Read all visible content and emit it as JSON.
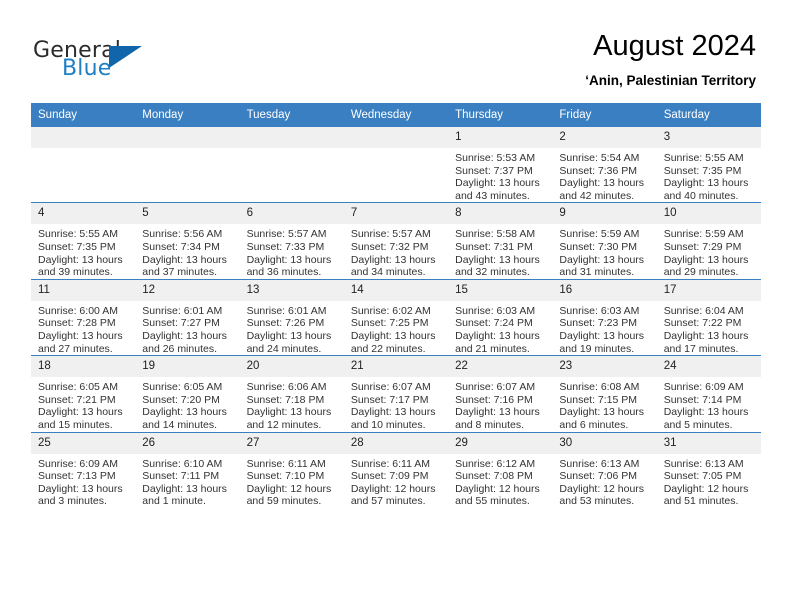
{
  "brand": {
    "name_top": "General",
    "name_bottom": "Blue",
    "accent_color": "#1166ab",
    "text_color": "#1f7fc4"
  },
  "header": {
    "title": "August 2024",
    "subtitle": "‘Anin, Palestinian Territory"
  },
  "theme": {
    "header_row_bg": "#3a7fc1",
    "daynum_bg": "#f0f0f0",
    "grid_line": "#3a7fc1",
    "body_text": "#333333"
  },
  "weekday_headers": [
    "Sunday",
    "Monday",
    "Tuesday",
    "Wednesday",
    "Thursday",
    "Friday",
    "Saturday"
  ],
  "weeks": [
    [
      {
        "day": "",
        "empty": true
      },
      {
        "day": "",
        "empty": true
      },
      {
        "day": "",
        "empty": true
      },
      {
        "day": "",
        "empty": true
      },
      {
        "day": "1",
        "sunrise": "Sunrise: 5:53 AM",
        "sunset": "Sunset: 7:37 PM",
        "daylight": "Daylight: 13 hours and 43 minutes."
      },
      {
        "day": "2",
        "sunrise": "Sunrise: 5:54 AM",
        "sunset": "Sunset: 7:36 PM",
        "daylight": "Daylight: 13 hours and 42 minutes."
      },
      {
        "day": "3",
        "sunrise": "Sunrise: 5:55 AM",
        "sunset": "Sunset: 7:35 PM",
        "daylight": "Daylight: 13 hours and 40 minutes."
      }
    ],
    [
      {
        "day": "4",
        "sunrise": "Sunrise: 5:55 AM",
        "sunset": "Sunset: 7:35 PM",
        "daylight": "Daylight: 13 hours and 39 minutes."
      },
      {
        "day": "5",
        "sunrise": "Sunrise: 5:56 AM",
        "sunset": "Sunset: 7:34 PM",
        "daylight": "Daylight: 13 hours and 37 minutes."
      },
      {
        "day": "6",
        "sunrise": "Sunrise: 5:57 AM",
        "sunset": "Sunset: 7:33 PM",
        "daylight": "Daylight: 13 hours and 36 minutes."
      },
      {
        "day": "7",
        "sunrise": "Sunrise: 5:57 AM",
        "sunset": "Sunset: 7:32 PM",
        "daylight": "Daylight: 13 hours and 34 minutes."
      },
      {
        "day": "8",
        "sunrise": "Sunrise: 5:58 AM",
        "sunset": "Sunset: 7:31 PM",
        "daylight": "Daylight: 13 hours and 32 minutes."
      },
      {
        "day": "9",
        "sunrise": "Sunrise: 5:59 AM",
        "sunset": "Sunset: 7:30 PM",
        "daylight": "Daylight: 13 hours and 31 minutes."
      },
      {
        "day": "10",
        "sunrise": "Sunrise: 5:59 AM",
        "sunset": "Sunset: 7:29 PM",
        "daylight": "Daylight: 13 hours and 29 minutes."
      }
    ],
    [
      {
        "day": "11",
        "sunrise": "Sunrise: 6:00 AM",
        "sunset": "Sunset: 7:28 PM",
        "daylight": "Daylight: 13 hours and 27 minutes."
      },
      {
        "day": "12",
        "sunrise": "Sunrise: 6:01 AM",
        "sunset": "Sunset: 7:27 PM",
        "daylight": "Daylight: 13 hours and 26 minutes."
      },
      {
        "day": "13",
        "sunrise": "Sunrise: 6:01 AM",
        "sunset": "Sunset: 7:26 PM",
        "daylight": "Daylight: 13 hours and 24 minutes."
      },
      {
        "day": "14",
        "sunrise": "Sunrise: 6:02 AM",
        "sunset": "Sunset: 7:25 PM",
        "daylight": "Daylight: 13 hours and 22 minutes."
      },
      {
        "day": "15",
        "sunrise": "Sunrise: 6:03 AM",
        "sunset": "Sunset: 7:24 PM",
        "daylight": "Daylight: 13 hours and 21 minutes."
      },
      {
        "day": "16",
        "sunrise": "Sunrise: 6:03 AM",
        "sunset": "Sunset: 7:23 PM",
        "daylight": "Daylight: 13 hours and 19 minutes."
      },
      {
        "day": "17",
        "sunrise": "Sunrise: 6:04 AM",
        "sunset": "Sunset: 7:22 PM",
        "daylight": "Daylight: 13 hours and 17 minutes."
      }
    ],
    [
      {
        "day": "18",
        "sunrise": "Sunrise: 6:05 AM",
        "sunset": "Sunset: 7:21 PM",
        "daylight": "Daylight: 13 hours and 15 minutes."
      },
      {
        "day": "19",
        "sunrise": "Sunrise: 6:05 AM",
        "sunset": "Sunset: 7:20 PM",
        "daylight": "Daylight: 13 hours and 14 minutes."
      },
      {
        "day": "20",
        "sunrise": "Sunrise: 6:06 AM",
        "sunset": "Sunset: 7:18 PM",
        "daylight": "Daylight: 13 hours and 12 minutes."
      },
      {
        "day": "21",
        "sunrise": "Sunrise: 6:07 AM",
        "sunset": "Sunset: 7:17 PM",
        "daylight": "Daylight: 13 hours and 10 minutes."
      },
      {
        "day": "22",
        "sunrise": "Sunrise: 6:07 AM",
        "sunset": "Sunset: 7:16 PM",
        "daylight": "Daylight: 13 hours and 8 minutes."
      },
      {
        "day": "23",
        "sunrise": "Sunrise: 6:08 AM",
        "sunset": "Sunset: 7:15 PM",
        "daylight": "Daylight: 13 hours and 6 minutes."
      },
      {
        "day": "24",
        "sunrise": "Sunrise: 6:09 AM",
        "sunset": "Sunset: 7:14 PM",
        "daylight": "Daylight: 13 hours and 5 minutes."
      }
    ],
    [
      {
        "day": "25",
        "sunrise": "Sunrise: 6:09 AM",
        "sunset": "Sunset: 7:13 PM",
        "daylight": "Daylight: 13 hours and 3 minutes."
      },
      {
        "day": "26",
        "sunrise": "Sunrise: 6:10 AM",
        "sunset": "Sunset: 7:11 PM",
        "daylight": "Daylight: 13 hours and 1 minute."
      },
      {
        "day": "27",
        "sunrise": "Sunrise: 6:11 AM",
        "sunset": "Sunset: 7:10 PM",
        "daylight": "Daylight: 12 hours and 59 minutes."
      },
      {
        "day": "28",
        "sunrise": "Sunrise: 6:11 AM",
        "sunset": "Sunset: 7:09 PM",
        "daylight": "Daylight: 12 hours and 57 minutes."
      },
      {
        "day": "29",
        "sunrise": "Sunrise: 6:12 AM",
        "sunset": "Sunset: 7:08 PM",
        "daylight": "Daylight: 12 hours and 55 minutes."
      },
      {
        "day": "30",
        "sunrise": "Sunrise: 6:13 AM",
        "sunset": "Sunset: 7:06 PM",
        "daylight": "Daylight: 12 hours and 53 minutes."
      },
      {
        "day": "31",
        "sunrise": "Sunrise: 6:13 AM",
        "sunset": "Sunset: 7:05 PM",
        "daylight": "Daylight: 12 hours and 51 minutes."
      }
    ]
  ]
}
